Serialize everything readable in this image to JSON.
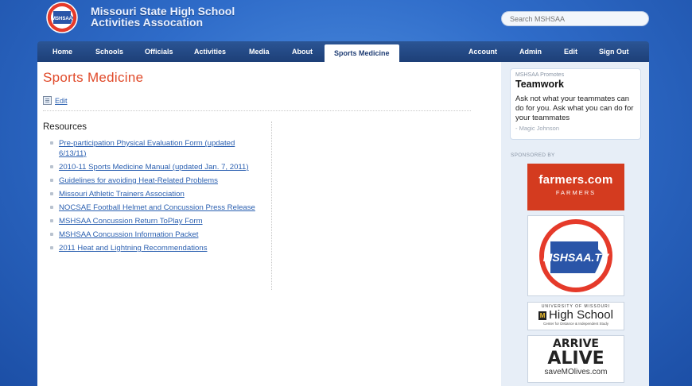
{
  "header": {
    "logo_text": "MSHSAA",
    "title_line1": "Missouri State High School",
    "title_line2": "Activities Assocation",
    "search_placeholder": "Search MSHSAA"
  },
  "nav": {
    "left": [
      "Home",
      "Schools",
      "Officials",
      "Activities",
      "Media",
      "About",
      "Sports Medicine"
    ],
    "right": [
      "Account",
      "Admin",
      "Edit",
      "Sign Out"
    ],
    "active": "Sports Medicine"
  },
  "main": {
    "page_title": "Sports Medicine",
    "edit_label": "Edit",
    "resources_heading": "Resources",
    "resources": [
      "Pre-participation Physical Evaluation Form (updated 6/13/11)",
      "2010-11 Sports Medicine Manual (updated Jan. 7, 2011)",
      "Guidelines for avoiding Heat-Related Problems",
      "Missouri Athletic Trainers Association",
      "NOCSAE Football Helmet and Concussion Press Release",
      "MSHSAA Concussion Return ToPlay Form",
      "MSHSAA Concussion Information Packet",
      "2011 Heat and Lightning Recommendations"
    ]
  },
  "sidebar": {
    "promo_kicker": "MSHSAA Promotes",
    "promo_title": "Teamwork",
    "promo_quote": "Ask not what your teammates can do for you. Ask what you can do for your teammates",
    "promo_author": "- Magic Johnson",
    "sponsored_label": "SPONSORED BY",
    "ads": {
      "farmers_main": "farmers.com",
      "farmers_sub": "FARMERS",
      "tv": "MSHSAA.TV",
      "hs_top": "UNIVERSITY OF MISSOURI",
      "hs_main": "High School",
      "hs_sub": "Center for Distance & Independent Study",
      "alive_1": "ARRIVE",
      "alive_2": "ALIVE",
      "alive_3": "saveMOlives.com"
    }
  },
  "colors": {
    "background": "#2f6cc9",
    "nav": "#1f3d74",
    "title_accent": "#e04a2a",
    "link": "#2a5fb0",
    "farmers": "#d43b1f"
  }
}
